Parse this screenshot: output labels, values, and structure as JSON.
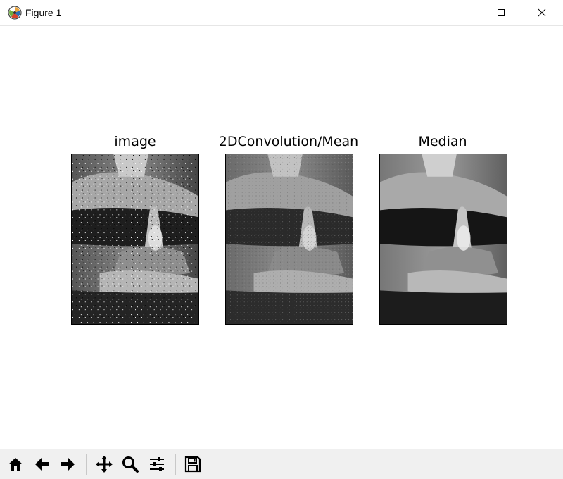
{
  "window": {
    "title": "Figure 1",
    "app_icon": "matplotlib-icon",
    "controls": [
      "minimize-icon",
      "maximize-icon",
      "close-icon"
    ]
  },
  "subplots": [
    {
      "title": "image",
      "content": "grayscale photo of glass vessels with salt-and-pepper noise"
    },
    {
      "title": "2DConvolution/Mean",
      "content": "mean-filtered grayscale photo"
    },
    {
      "title": "Median",
      "content": "median-filtered grayscale photo"
    }
  ],
  "toolbar": {
    "tools": [
      {
        "name": "home-icon"
      },
      {
        "name": "back-arrow-icon"
      },
      {
        "name": "forward-arrow-icon"
      },
      {
        "name": "pan-icon"
      },
      {
        "name": "zoom-icon"
      },
      {
        "name": "configure-subplots-icon"
      },
      {
        "name": "save-icon"
      }
    ]
  },
  "colors": {
    "toolbar_bg": "#f0f0f0",
    "axes_border": "#000000",
    "canvas_bg": "#ffffff"
  }
}
